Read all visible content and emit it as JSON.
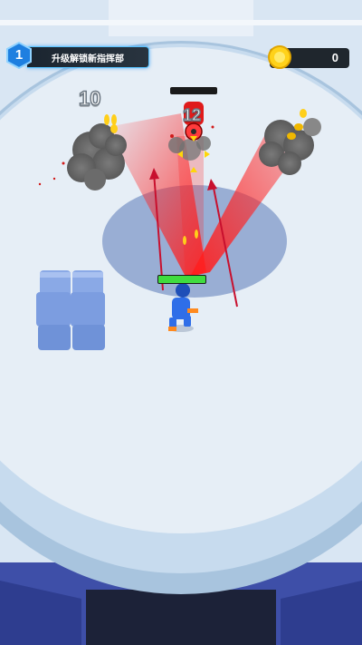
{
  "hud": {
    "level": "1",
    "level_label": "升级解锁新指挥部",
    "coins": "0"
  },
  "world": {
    "left_pile_number": "10",
    "target_number": "12",
    "player_health_fraction": 1.0
  },
  "colors": {
    "accent_blue": "#58c3ff",
    "laser_red": "#ff1f1f",
    "coin_gold": "#ffd21a",
    "health_green": "#3fdc3f"
  }
}
